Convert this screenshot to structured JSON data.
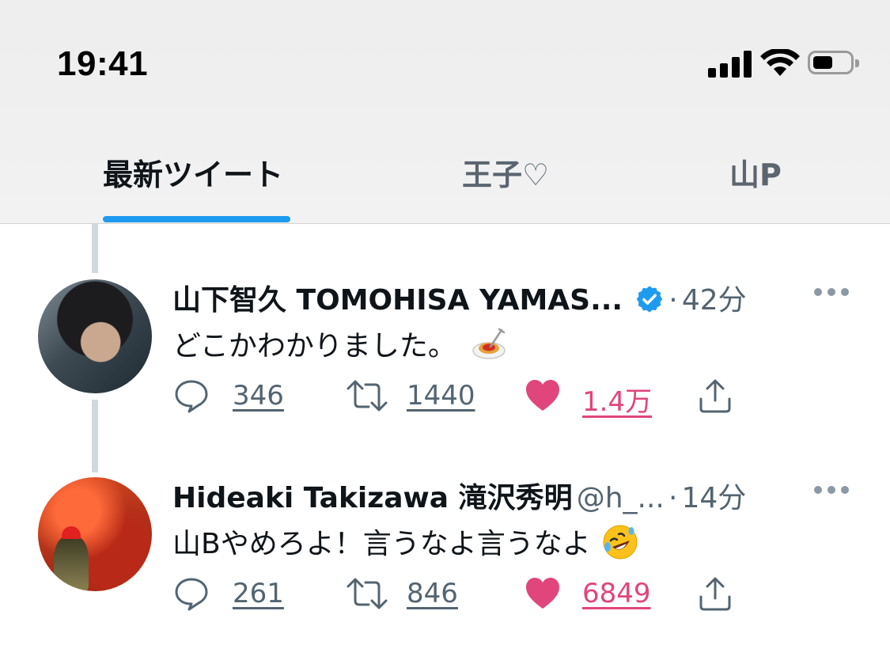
{
  "status_bar": {
    "time": "19:41"
  },
  "tabs": [
    {
      "label": "最新ツイート",
      "active": true
    },
    {
      "label": "王子♡",
      "active": false
    },
    {
      "label": "山P",
      "active": false
    }
  ],
  "colors": {
    "accent": "#1d9bf0",
    "like": "#e0457b",
    "secondary_text": "#536471"
  },
  "tweets": [
    {
      "display_name": "山下智久 TOMOHISA YAMAS...",
      "verified": true,
      "handle": "",
      "separator": "·",
      "time": "42分",
      "text": "どこかわかりました。",
      "emoji": "spaghetti-emoji",
      "replies": "346",
      "retweets": "1440",
      "likes": "1.4万",
      "liked": true
    },
    {
      "display_name": "Hideaki Takizawa 滝沢秀明",
      "verified": false,
      "handle": "@h_...",
      "separator": "·",
      "time": "14分",
      "text": "山Bやめろよ！言うなよ言うなよ",
      "emoji": "rolling-on-floor-laughing-emoji",
      "replies": "261",
      "retweets": "846",
      "likes": "6849",
      "liked": true
    }
  ]
}
